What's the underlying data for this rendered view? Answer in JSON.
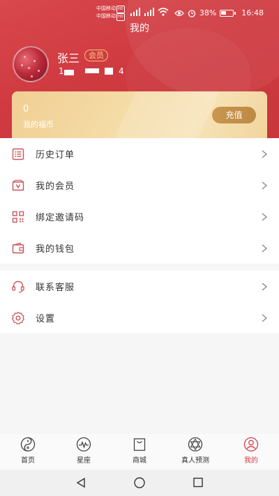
{
  "status_bar": {
    "carrier_1": "中国移动",
    "carrier_2": "中国移动",
    "hd": "HD",
    "battery": "38%",
    "time": "16:48"
  },
  "page": {
    "title": "我的"
  },
  "user": {
    "name": "张三",
    "badge": "会员",
    "phone_start": "1",
    "phone_end": "4"
  },
  "wallet_card": {
    "coin_value": "0",
    "coin_label": "我的福币",
    "recharge_label": "充值"
  },
  "menu_primary": [
    {
      "label": "历史订单",
      "icon": "order-list-icon"
    },
    {
      "label": "我的会员",
      "icon": "member-card-icon"
    },
    {
      "label": "绑定邀请码",
      "icon": "qr-code-icon"
    },
    {
      "label": "我的钱包",
      "icon": "wallet-icon"
    }
  ],
  "menu_secondary": [
    {
      "label": "联系客服",
      "icon": "headset-icon"
    },
    {
      "label": "设置",
      "icon": "gear-icon"
    }
  ],
  "tabbar": {
    "active": "我的",
    "items": [
      {
        "label": "首页",
        "icon": "yin-yang-icon"
      },
      {
        "label": "星座",
        "icon": "pulse-icon"
      },
      {
        "label": "商城",
        "icon": "shopping-bag-icon"
      },
      {
        "label": "真人预测",
        "icon": "hexagram-icon"
      },
      {
        "label": "我的",
        "icon": "user-icon"
      }
    ]
  },
  "colors": {
    "header_red": "#cf3a40",
    "gold": "#c9964f",
    "icon_red": "#c9555a",
    "active_tab": "#d64045"
  }
}
